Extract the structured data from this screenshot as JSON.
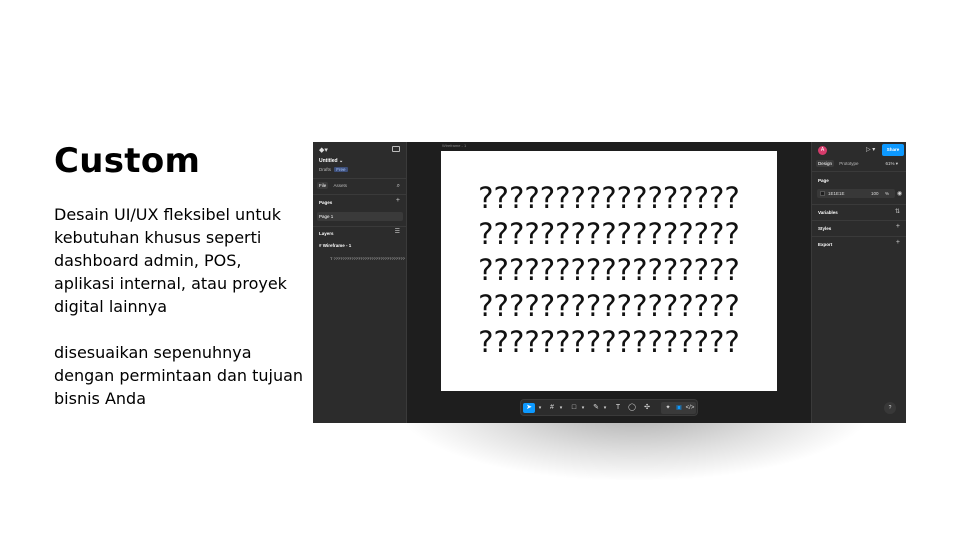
{
  "slide": {
    "heading": "Custom",
    "paragraph1": "Desain UI/UX fleksibel untuk kebutuhan khusus seperti dashboard admin, POS, aplikasi internal, atau proyek digital lainnya",
    "paragraph2": "disesuaikan sepenuhnya dengan permintaan dan tujuan bisnis Anda"
  },
  "editor": {
    "left_panel": {
      "file_title": "Untitled",
      "file_location": "Drafts",
      "plan_badge": "Free",
      "tabs": [
        "File",
        "Assets"
      ],
      "pages_label": "Pages",
      "pages": [
        "Page 1"
      ],
      "layers_label": "Layers",
      "layers": {
        "frame": "Wireframe - 1",
        "text": "??????????????????????????????????????????????????????????????????????????"
      }
    },
    "canvas": {
      "frame_label": "Wireframe - 1",
      "lines": [
        "?????????????????",
        "?????????????????",
        "?????????????????",
        "?????????????????",
        "?????????????????"
      ]
    },
    "right_panel": {
      "avatar_initial": "A",
      "share_label": "Share",
      "tabs": [
        "Design",
        "Prototype"
      ],
      "zoom": "61%",
      "page_label": "Page",
      "bg_hex": "1E1E1E",
      "bg_opacity": "100",
      "bg_opacity_unit": "%",
      "variables_label": "Variables",
      "styles_label": "Styles",
      "export_label": "Export",
      "help": "?"
    },
    "toolbar_icons": [
      "move-icon",
      "frame-icon",
      "rectangle-icon",
      "pen-icon",
      "text-icon",
      "comment-icon",
      "actions-icon",
      "dev-mode-icon"
    ]
  },
  "colors": {
    "editor_bg": "#2c2c2c",
    "canvas_bg": "#1e1e1e",
    "accent": "#0d99ff",
    "avatar": "#d63b6b"
  }
}
